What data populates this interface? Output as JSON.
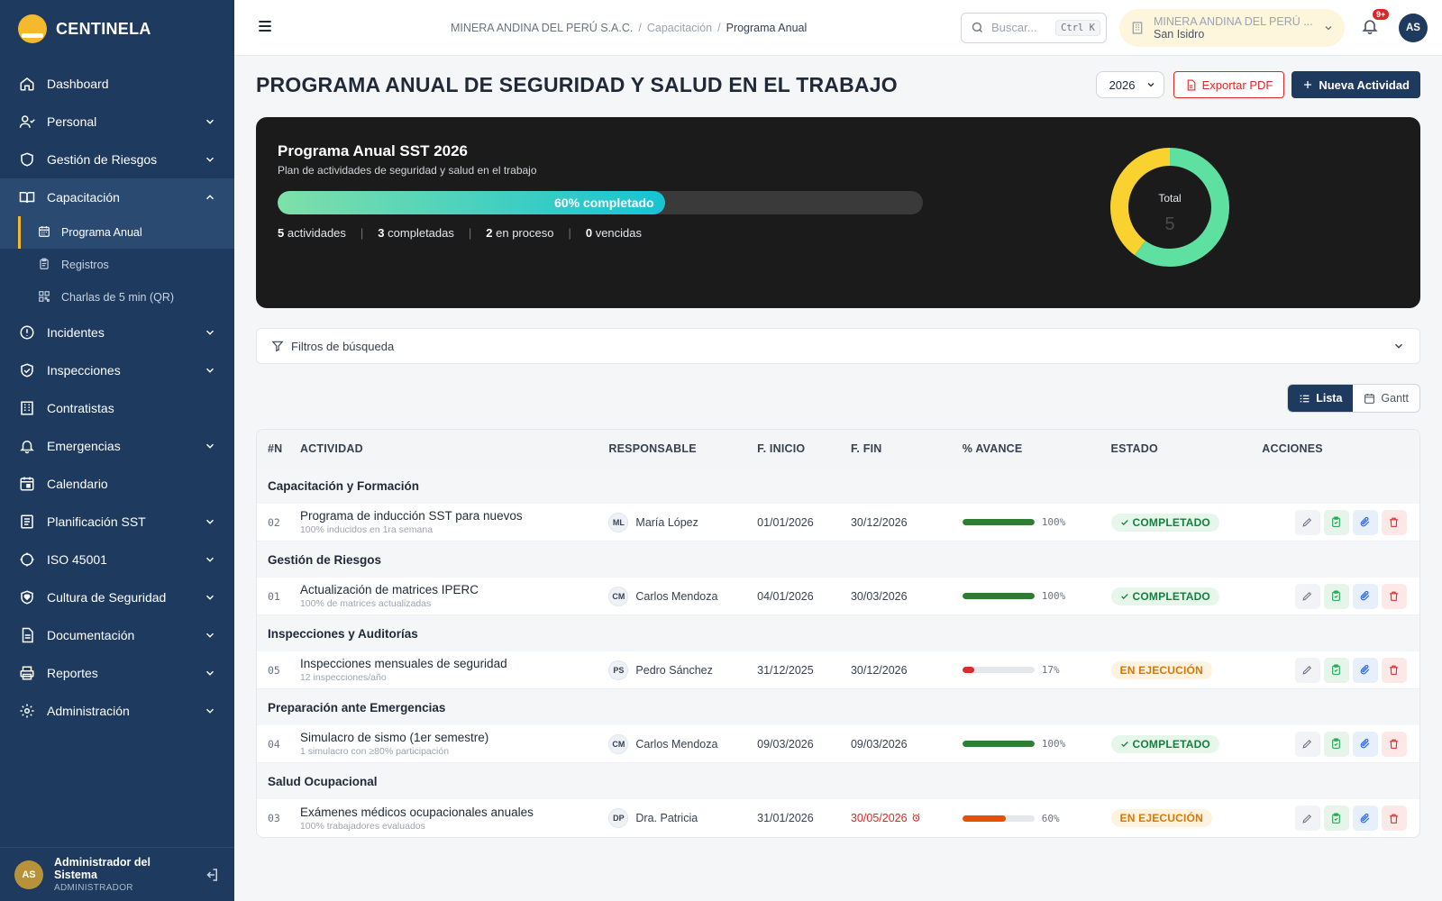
{
  "app": {
    "name": "CENTINELA"
  },
  "sidebar": {
    "items": [
      {
        "label": "Dashboard",
        "icon": "home-icon"
      },
      {
        "label": "Personal",
        "icon": "users-icon"
      },
      {
        "label": "Gestión de Riesgos",
        "icon": "shield-icon"
      },
      {
        "label": "Capacitación",
        "icon": "book-icon"
      },
      {
        "label": "Incidentes",
        "icon": "alert-icon"
      },
      {
        "label": "Inspecciones",
        "icon": "shield-check-icon"
      },
      {
        "label": "Contratistas",
        "icon": "building-icon"
      },
      {
        "label": "Emergencias",
        "icon": "bell-icon"
      },
      {
        "label": "Calendario",
        "icon": "calendar-icon"
      },
      {
        "label": "Planificación SST",
        "icon": "clipboard-icon"
      },
      {
        "label": "ISO 45001",
        "icon": "iso-icon"
      },
      {
        "label": "Cultura de Seguridad",
        "icon": "shield-heart-icon"
      },
      {
        "label": "Documentación",
        "icon": "document-icon"
      },
      {
        "label": "Reportes",
        "icon": "printer-icon"
      },
      {
        "label": "Administración",
        "icon": "gear-icon"
      }
    ],
    "subitems": [
      {
        "label": "Programa Anual",
        "icon": "calendar-grid-icon"
      },
      {
        "label": "Registros",
        "icon": "clipboard-list-icon"
      },
      {
        "label": "Charlas de 5 min (QR)",
        "icon": "qr-icon"
      }
    ],
    "user": {
      "initials": "AS",
      "name": "Administrador del Sistema",
      "role": "ADMINISTRADOR"
    }
  },
  "header": {
    "breadcrumb": [
      "MINERA ANDINA DEL PERÚ S.A.C.",
      "Capacitación",
      "Programa Anual"
    ],
    "search_placeholder": "Buscar...",
    "search_shortcut": "Ctrl K",
    "company_name": "MINERA ANDINA DEL PERÚ ...",
    "company_location": "San Isidro",
    "notifications": "9+",
    "avatar": "AS"
  },
  "page": {
    "title": "PROGRAMA ANUAL DE SEGURIDAD Y SALUD EN EL TRABAJO",
    "year": "2026",
    "export_label": "Exportar PDF",
    "new_label": "Nueva Actividad"
  },
  "summary": {
    "title": "Programa Anual SST 2026",
    "subtitle": "Plan de actividades de seguridad y salud en el trabajo",
    "progress_percent": 60,
    "progress_label": "60% completado",
    "stats": {
      "activities": "5",
      "activities_label": "actividades",
      "completed": "3",
      "completed_label": "completadas",
      "in_progress": "2",
      "in_progress_label": "en proceso",
      "overdue": "0",
      "overdue_label": "vencidas"
    },
    "donut": {
      "label": "Total",
      "value": "5",
      "segments": [
        {
          "value": 3,
          "color": "#5ee0a0"
        },
        {
          "value": 2,
          "color": "#f9d22f"
        }
      ]
    }
  },
  "filters": {
    "label": "Filtros de búsqueda"
  },
  "view": {
    "list": "Lista",
    "gantt": "Gantt"
  },
  "table": {
    "headers": [
      "#N",
      "ACTIVIDAD",
      "RESPONSABLE",
      "F. INICIO",
      "F. FIN",
      "% AVANCE",
      "ESTADO",
      "ACCIONES"
    ],
    "groups": [
      {
        "name": "Capacitación y Formación",
        "rows": [
          {
            "n": "02",
            "title": "Programa de inducción SST para nuevos",
            "sub": "100% inducidos en 1ra semana",
            "initials": "ML",
            "resp": "María López",
            "start": "01/01/2026",
            "end": "30/12/2026",
            "end_overdue": false,
            "progress": 100,
            "pct": "100%",
            "bar_color": "#2e7d32",
            "status": "COMPLETADO",
            "status_type": "done"
          }
        ]
      },
      {
        "name": "Gestión de Riesgos",
        "rows": [
          {
            "n": "01",
            "title": "Actualización de matrices IPERC",
            "sub": "100% de matrices actualizadas",
            "initials": "CM",
            "resp": "Carlos Mendoza",
            "start": "04/01/2026",
            "end": "30/03/2026",
            "end_overdue": false,
            "progress": 100,
            "pct": "100%",
            "bar_color": "#2e7d32",
            "status": "COMPLETADO",
            "status_type": "done"
          }
        ]
      },
      {
        "name": "Inspecciones y Auditorías",
        "rows": [
          {
            "n": "05",
            "title": "Inspecciones mensuales de seguridad",
            "sub": "12 inspecciones/año",
            "initials": "PS",
            "resp": "Pedro Sánchez",
            "start": "31/12/2025",
            "end": "30/12/2026",
            "end_overdue": false,
            "progress": 17,
            "pct": "17%",
            "bar_color": "#d32f2f",
            "status": "EN EJECUCIÓN",
            "status_type": "run"
          }
        ]
      },
      {
        "name": "Preparación ante Emergencias",
        "rows": [
          {
            "n": "04",
            "title": "Simulacro de sismo (1er semestre)",
            "sub": "1 simulacro con ≥80% participación",
            "initials": "CM",
            "resp": "Carlos Mendoza",
            "start": "09/03/2026",
            "end": "09/03/2026",
            "end_overdue": false,
            "progress": 100,
            "pct": "100%",
            "bar_color": "#2e7d32",
            "status": "COMPLETADO",
            "status_type": "done"
          }
        ]
      },
      {
        "name": "Salud Ocupacional",
        "rows": [
          {
            "n": "03",
            "title": "Exámenes médicos ocupacionales anuales",
            "sub": "100% trabajadores evaluados",
            "initials": "DP",
            "resp": "Dra. Patricia",
            "start": "31/01/2026",
            "end": "30/05/2026",
            "end_overdue": true,
            "progress": 60,
            "pct": "60%",
            "bar_color": "#e65100",
            "status": "EN EJECUCIÓN",
            "status_type": "run"
          }
        ]
      }
    ]
  }
}
